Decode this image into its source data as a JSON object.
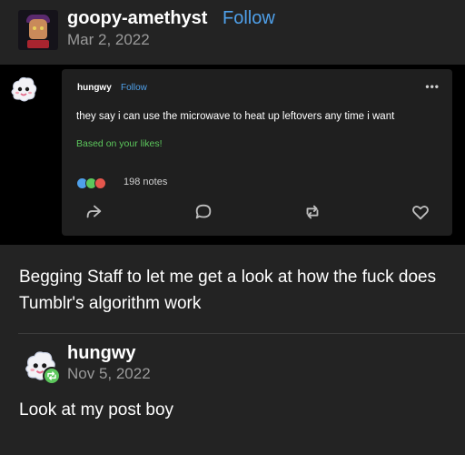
{
  "post": {
    "username": "goopy-amethyst",
    "follow_label": "Follow",
    "date": "Mar 2, 2022",
    "caption": "Begging Staff to let me get a look at how the fuck does Tumblr's algorithm work"
  },
  "embedded": {
    "username": "hungwy",
    "follow_label": "Follow",
    "menu": "•••",
    "text": "they say i can use the microwave to heat up leftovers any time i want",
    "recommendation": "Based on your likes!",
    "notes": "198 notes",
    "icons": [
      "share-icon",
      "reply-icon",
      "reblog-icon",
      "like-icon"
    ]
  },
  "reblog": {
    "username": "hungwy",
    "date": "Nov 5, 2022",
    "text": "Look at my post boy"
  },
  "colors": {
    "background": "#232323",
    "link": "#4fa0ea",
    "green": "#5cc75c",
    "red": "#e4564c"
  }
}
